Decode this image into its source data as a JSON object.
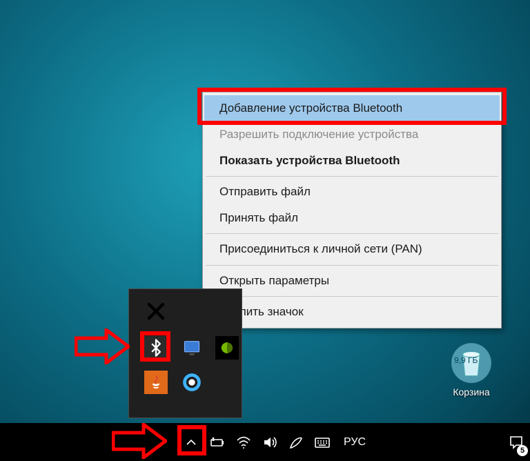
{
  "context_menu": {
    "items": [
      {
        "label": "Добавление устройства Bluetooth",
        "state": "highlight"
      },
      {
        "label": "Разрешить подключение устройства",
        "state": "disabled"
      },
      {
        "label": "Показать устройства Bluetooth",
        "state": "bold"
      }
    ],
    "group2": [
      {
        "label": "Отправить файл"
      },
      {
        "label": "Принять файл"
      }
    ],
    "group3": [
      {
        "label": "Присоединиться к личной сети (PAN)"
      }
    ],
    "group4": [
      {
        "label": "Открыть параметры"
      }
    ],
    "group5": [
      {
        "label": "Удалить значок"
      }
    ]
  },
  "tray_icons": {
    "bluetooth": "bluetooth-icon",
    "display": "display-adapter-icon",
    "nvidia": "nvidia-icon",
    "java": "java-icon",
    "cortana": "cortana-icon",
    "muted": "muted-app-icon"
  },
  "recycle_bin": {
    "label": "Корзина",
    "size": "9,9 ГБ"
  },
  "taskbar": {
    "lang": "РУС",
    "notification_count": "5"
  }
}
